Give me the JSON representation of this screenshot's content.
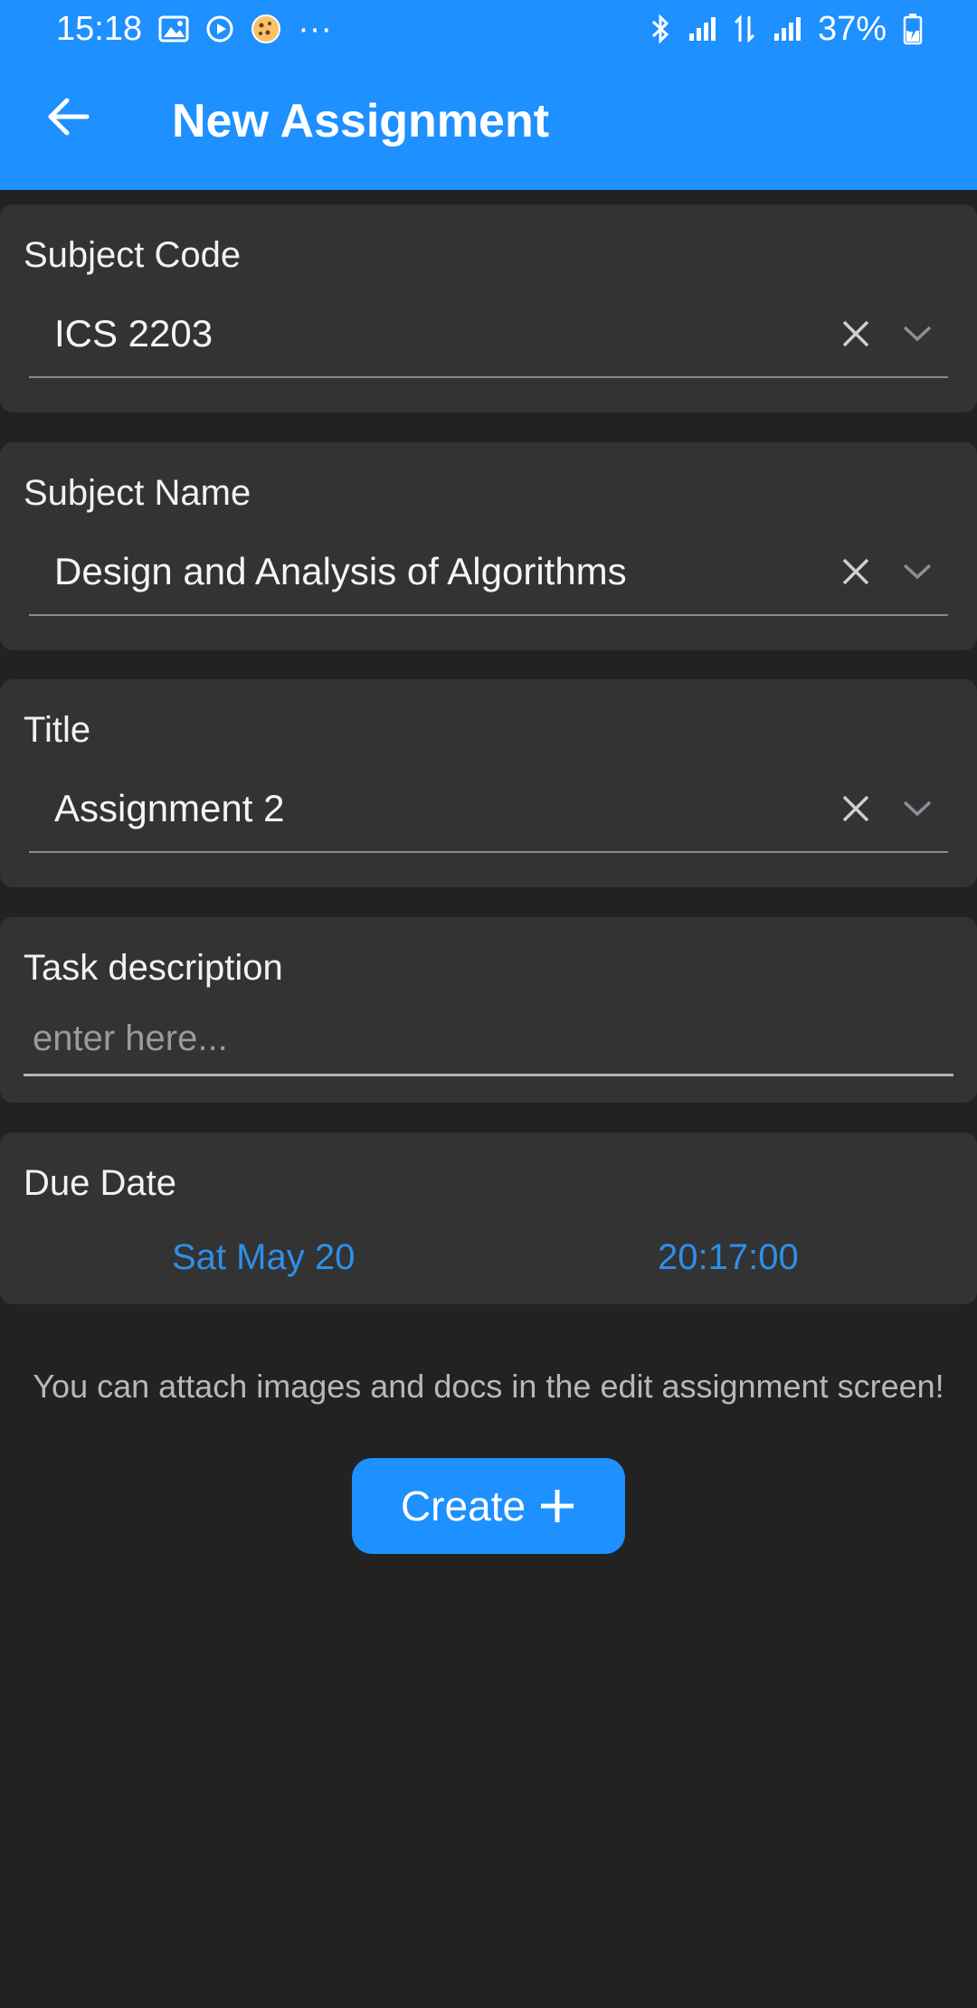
{
  "status_bar": {
    "time": "15:18",
    "battery": "37%",
    "more_dots": "···",
    "icons_left": [
      "gallery-icon",
      "play-icon",
      "cookie-app-icon"
    ],
    "icons_right": [
      "bluetooth-icon",
      "signal-icon",
      "data-icon",
      "signal-icon",
      "battery-charging-icon"
    ]
  },
  "app_bar": {
    "title": "New Assignment",
    "back_icon": "arrow-left-icon"
  },
  "form": {
    "subject_code": {
      "label": "Subject Code",
      "value": "ICS 2203"
    },
    "subject_name": {
      "label": "Subject Name",
      "value": "Design and Analysis of Algorithms"
    },
    "title": {
      "label": "Title",
      "value": "Assignment 2"
    },
    "task_description": {
      "label": "Task description",
      "value": "",
      "placeholder": "enter here..."
    },
    "due_date": {
      "label": "Due Date",
      "date": "Sat May 20",
      "time": "20:17:00"
    }
  },
  "hint": "You can attach images and docs in the edit assignment screen!",
  "create_button": {
    "label": "Create",
    "icon": "plus-icon"
  },
  "colors": {
    "primary": "#1e90ff",
    "background": "#222222",
    "card": "#333333",
    "link": "#2e8fe8"
  }
}
